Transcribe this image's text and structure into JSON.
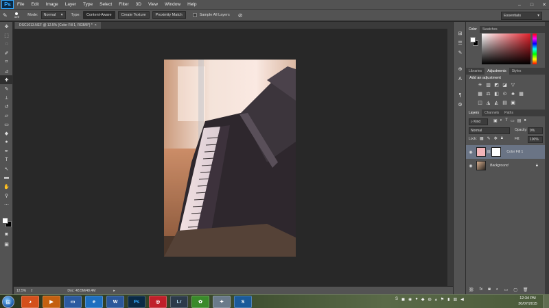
{
  "app": {
    "logo": "Ps"
  },
  "menu": [
    "File",
    "Edit",
    "Image",
    "Layer",
    "Type",
    "Select",
    "Filter",
    "3D",
    "View",
    "Window",
    "Help"
  ],
  "window_controls": {
    "minimize": "–",
    "maximize": "□",
    "close": "✕"
  },
  "options_bar": {
    "brush_size": "120",
    "mode_label": "Mode:",
    "mode_value": "Normal",
    "type_label": "Type:",
    "type_buttons": [
      "Content-Aware",
      "Create Texture",
      "Proximity Match"
    ],
    "sample_all_layers": "Sample All Layers",
    "workspace": "Essentials"
  },
  "document": {
    "tab_title": "DSC1013.NEF @ 12.5% (Color Fill 1, RGB/8*) *",
    "tab_close": "×"
  },
  "status_bar": {
    "zoom": "12.5%",
    "doc_size": "Doc: 48.5M/48.4M"
  },
  "color_panel": {
    "tabs": [
      "Color",
      "Swatches"
    ]
  },
  "adjustments_panel": {
    "tabs": [
      "Libraries",
      "Adjustments",
      "Styles"
    ],
    "title": "Add an adjustment"
  },
  "layers_panel": {
    "tabs": [
      "Layers",
      "Channels",
      "Paths"
    ],
    "filter_kind": "Kind",
    "blend_mode": "Normal",
    "opacity_label": "Opacity:",
    "opacity_value": "9%",
    "lock_label": "Lock:",
    "fill_label": "Fill:",
    "fill_value": "100%",
    "layers": [
      {
        "name": "Color Fill 1",
        "selected": true
      },
      {
        "name": "Background",
        "selected": false
      }
    ]
  },
  "taskbar": {
    "apps": [
      "Firefox",
      "Media Player",
      "Internet Explorer",
      "Word",
      "Photoshop",
      "Creative Cloud",
      "Lightroom",
      "Evernote",
      "Utility",
      "Snagit"
    ],
    "clock_time": "12:34 PM",
    "clock_date": "30/07/2015"
  },
  "colors": {
    "chrome": "#535353",
    "canvas_bg": "#282828",
    "selected_layer": "#6a7485",
    "fill_swatch": "#f2b4b8",
    "accent": "#31a8ff"
  }
}
